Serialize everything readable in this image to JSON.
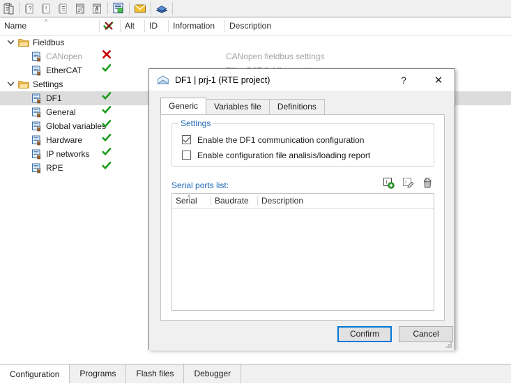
{
  "toolbar": {
    "buttons": [
      {
        "name": "clipboard-icon",
        "title": "Clipboard"
      },
      {
        "name": "page-question-icon",
        "title": "Page with question"
      },
      {
        "name": "page-warning-icon",
        "title": "Page with warning"
      },
      {
        "name": "page-list-icon",
        "title": "Page with list"
      },
      {
        "name": "window-code-icon",
        "title": "Window code"
      },
      {
        "name": "hand-page-icon",
        "title": "Hand page"
      },
      {
        "name": "report-icon",
        "title": "Report"
      },
      {
        "name": "mail-icon",
        "title": "Mail"
      },
      {
        "name": "book-icon",
        "title": "Book"
      }
    ]
  },
  "columns": {
    "name": "Name",
    "status": "",
    "alt": "Alt",
    "id": "ID",
    "information": "Information",
    "description": "Description"
  },
  "tree": [
    {
      "type": "folder",
      "label": "Fieldbus",
      "indent": 0,
      "expanded": true,
      "status": "",
      "desc": "",
      "selected": false,
      "dim": false
    },
    {
      "type": "item",
      "label": "CANopen",
      "indent": 1,
      "expanded": null,
      "status": "bad",
      "desc": "CANopen fieldbus settings",
      "selected": false,
      "dim": true
    },
    {
      "type": "item",
      "label": "EtherCAT",
      "indent": 1,
      "expanded": null,
      "status": "ok",
      "desc": "EtherCAT fieldbus settings",
      "selected": false,
      "dim": false
    },
    {
      "type": "folder",
      "label": "Settings",
      "indent": 0,
      "expanded": true,
      "status": "",
      "desc": "",
      "selected": false,
      "dim": false
    },
    {
      "type": "item",
      "label": "DF1",
      "indent": 1,
      "expanded": null,
      "status": "ok",
      "desc": "",
      "selected": true,
      "dim": false
    },
    {
      "type": "item",
      "label": "General",
      "indent": 1,
      "expanded": null,
      "status": "ok",
      "desc": "",
      "selected": false,
      "dim": false
    },
    {
      "type": "item",
      "label": "Global variables",
      "indent": 1,
      "expanded": null,
      "status": "ok",
      "desc": "",
      "selected": false,
      "dim": false
    },
    {
      "type": "item",
      "label": "Hardware",
      "indent": 1,
      "expanded": null,
      "status": "ok",
      "desc": "",
      "selected": false,
      "dim": false
    },
    {
      "type": "item",
      "label": "IP networks",
      "indent": 1,
      "expanded": null,
      "status": "ok",
      "desc": "",
      "selected": false,
      "dim": false
    },
    {
      "type": "item",
      "label": "RPE",
      "indent": 1,
      "expanded": null,
      "status": "ok",
      "desc": "",
      "selected": false,
      "dim": false
    }
  ],
  "dialog": {
    "title": "DF1 | prj-1 (RTE project)",
    "help_glyph": "?",
    "close_glyph": "✕",
    "tabs": [
      {
        "label": "Generic",
        "active": true
      },
      {
        "label": "Variables file",
        "active": false
      },
      {
        "label": "Definitions",
        "active": false
      }
    ],
    "settings_group": {
      "legend": "Settings",
      "checkboxes": [
        {
          "label": "Enable the DF1 communication configuration",
          "checked": true
        },
        {
          "label": "Enable configuration file analisis/loading report",
          "checked": false
        }
      ]
    },
    "serial_ports": {
      "label": "Serial ports list:",
      "actions": [
        {
          "name": "add-serial-port-icon",
          "title": "Add"
        },
        {
          "name": "edit-serial-port-icon",
          "title": "Edit"
        },
        {
          "name": "delete-serial-port-icon",
          "title": "Delete"
        }
      ],
      "columns": [
        "Serial",
        "Baudrate",
        "Description"
      ],
      "sorted_column": "Serial",
      "rows": []
    },
    "buttons": {
      "confirm": "Confirm",
      "cancel": "Cancel"
    }
  },
  "bottom_tabs": [
    {
      "label": "Configuration",
      "active": true
    },
    {
      "label": "Programs",
      "active": false
    },
    {
      "label": "Flash files",
      "active": false
    },
    {
      "label": "Debugger",
      "active": false
    }
  ],
  "colors": {
    "accent_blue": "#1c66b5",
    "focus_blue": "#0078d7",
    "status_ok": "#1a9c1a",
    "status_bad": "#cc0000",
    "folder_yellow": "#f5c761"
  }
}
